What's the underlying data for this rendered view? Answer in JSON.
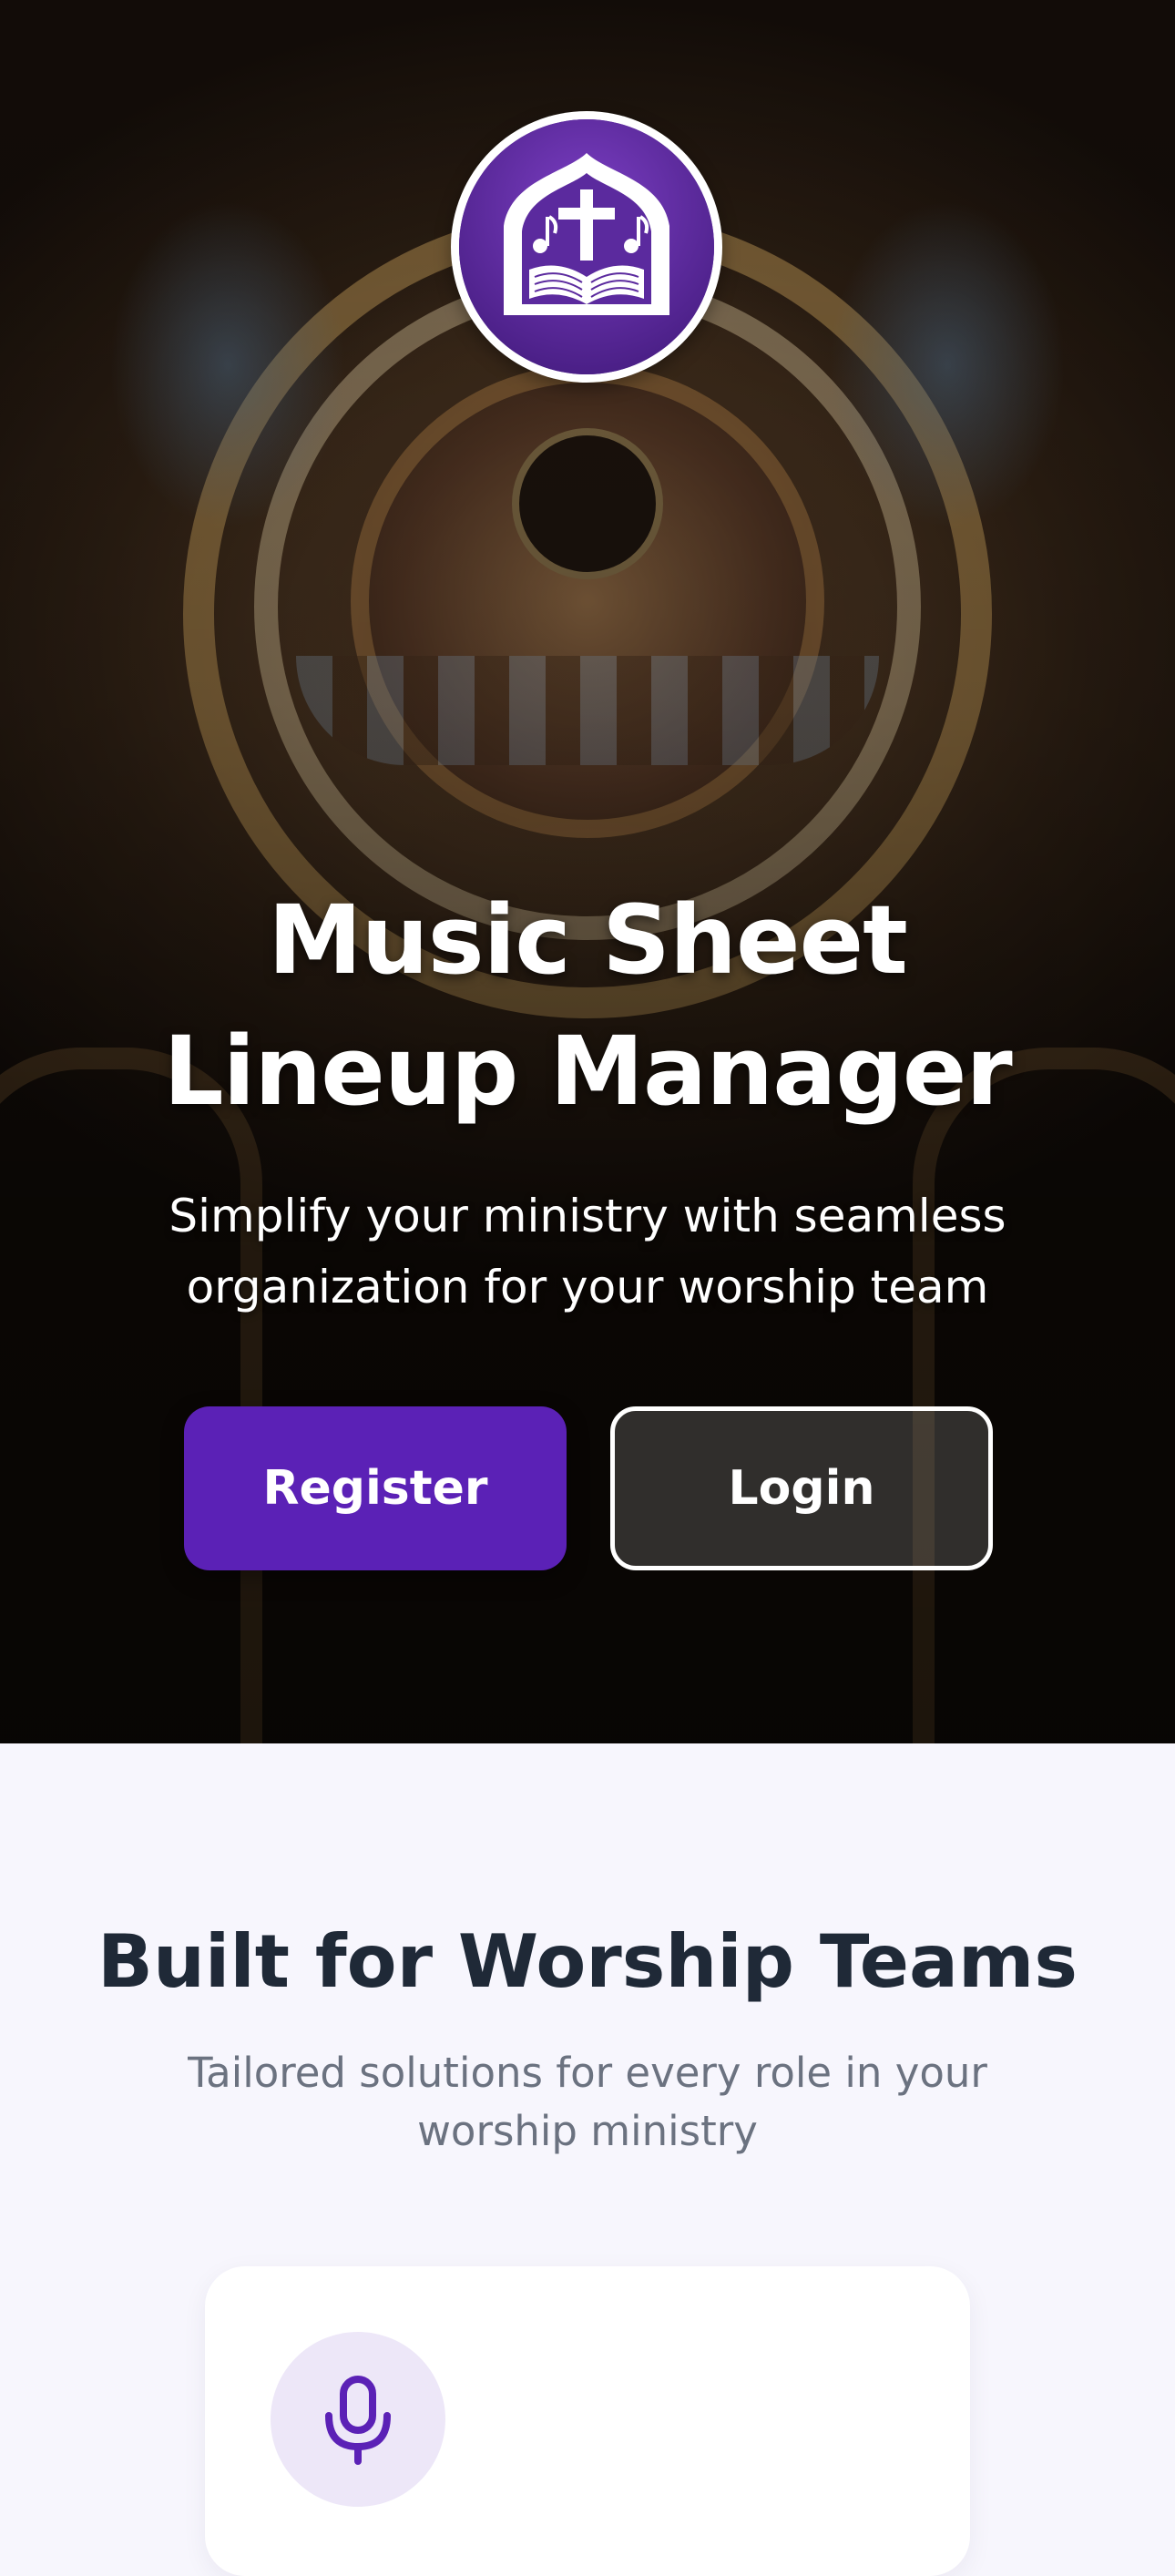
{
  "app": {
    "title": "Music Sheet Lineup Manager",
    "tagline": "Simplify your ministry with seamless organization for your worship team",
    "logo_icon": "cross-music-book-icon",
    "accent_color": "#5b21b6"
  },
  "hero": {
    "register_label": "Register",
    "login_label": "Login"
  },
  "features": {
    "title": "Built for Worship Teams",
    "subtitle": "Tailored solutions for every role in your worship ministry",
    "cards": [
      {
        "icon": "microphone-icon"
      }
    ]
  }
}
